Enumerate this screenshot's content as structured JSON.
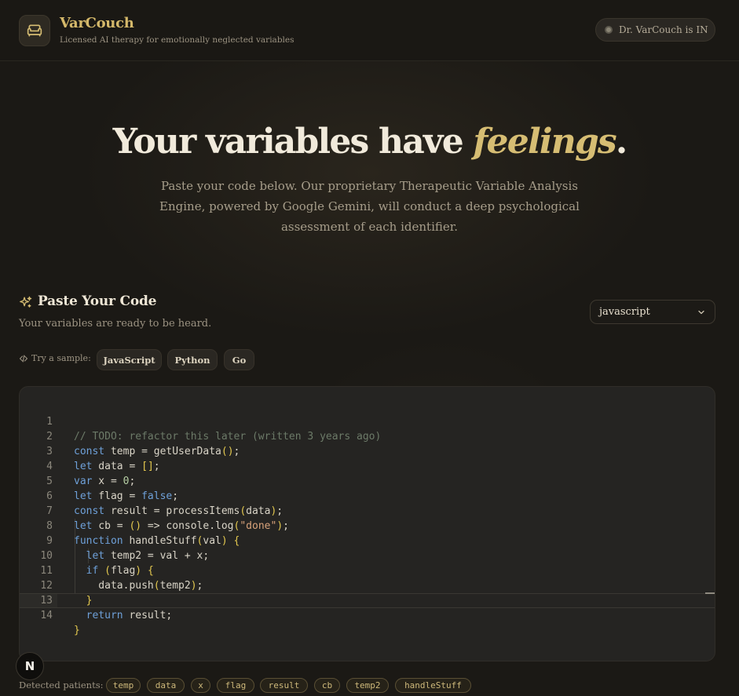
{
  "header": {
    "brand": "VarCouch",
    "tagline": "Licensed AI therapy for emotionally neglected variables",
    "status": "Dr. VarCouch is IN"
  },
  "hero": {
    "title_prefix": "Your variables have ",
    "title_emphasis": "feelings",
    "title_suffix": ".",
    "description": "Paste your code below. Our proprietary Therapeutic Variable Analysis Engine, powered by Google Gemini, will conduct a deep psychological assessment of each identifier."
  },
  "paste": {
    "title": "Paste Your Code",
    "subtitle": "Your variables are ready to be heard.",
    "language": "javascript",
    "try_label": "Try a sample:",
    "samples": [
      "JavaScript",
      "Python",
      "Go"
    ]
  },
  "editor": {
    "line_numbers": [
      "1",
      "2",
      "3",
      "4",
      "5",
      "6",
      "7",
      "8",
      "9",
      "10",
      "11",
      "12",
      "13",
      "14"
    ],
    "lines": [
      "// TODO: refactor this later (written 3 years ago)",
      "const temp = getUserData();",
      "let data = [];",
      "var x = 0;",
      "let flag = false;",
      "const result = processItems(data);",
      "let cb = () => console.log(\"done\");",
      "function handleStuff(val) {",
      "  let temp2 = val + x;",
      "  if (flag) {",
      "    data.push(temp2);",
      "  }",
      "  return result;",
      "}"
    ]
  },
  "footer": {
    "badge": "N",
    "detected_label": "Detected patients:",
    "patients": [
      "temp",
      "data",
      "x",
      "flag",
      "result",
      "cb",
      "temp2",
      "handleStuff"
    ]
  },
  "colors": {
    "accent_gold": "#d6bd73",
    "background": "#1b1915",
    "keyword_blue": "#6ea0d8",
    "bracket_yellow": "#e3c84f"
  }
}
